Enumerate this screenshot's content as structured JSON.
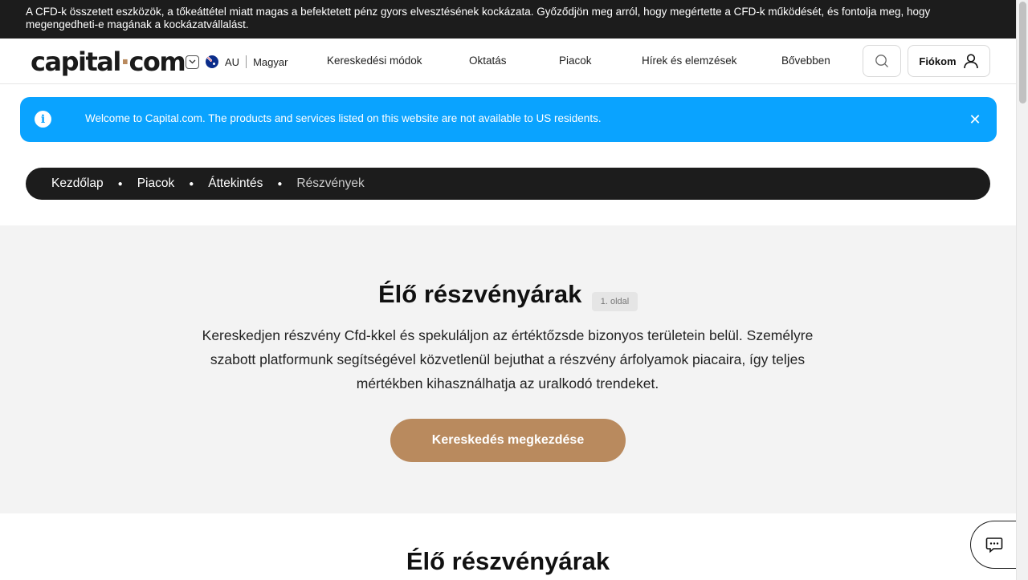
{
  "risk_warning": "A CFD-k összetett eszközök, a tőkeáttétel miatt magas a befektetett pénz gyors elvesztésének kockázata. Győződjön meg arról, hogy megértette a CFD-k működését, és fontolja meg, hogy megengedheti-e magának a kockázatvállalást.",
  "header": {
    "logo_left": "capital",
    "logo_dot": "·",
    "logo_right": "com",
    "region": "AU",
    "language": "Magyar",
    "nav": [
      "Kereskedési módok",
      "Oktatás",
      "Piacok",
      "Hírek és elemzések",
      "Bővebben"
    ],
    "account_label": "Fiókom"
  },
  "notice": {
    "message": "Welcome to Capital.com. The products and services listed on this website are not available to US residents.",
    "close": "✕"
  },
  "breadcrumb": [
    "Kezdőlap",
    "Piacok",
    "Áttekintés",
    "Részvények"
  ],
  "hero": {
    "title": "Élő részvényárak",
    "page_badge": "1. oldal",
    "description": "Kereskedjen részvény Cfd-kkel és spekuláljon az értéktőzsde bizonyos területein belül. Személyre szabott platformunk segítségével közvetlenül bejuthat a részvény árfolyamok piacaira, így teljes mértékben kihasználhatja az uralkodó trendeket.",
    "cta": "Kereskedés megkezdése"
  },
  "section_title": "Élő részvényárak",
  "colors": {
    "accent": "#b98a5e",
    "notice_bg": "#0aa3ff",
    "dark": "#1c1c1c"
  }
}
